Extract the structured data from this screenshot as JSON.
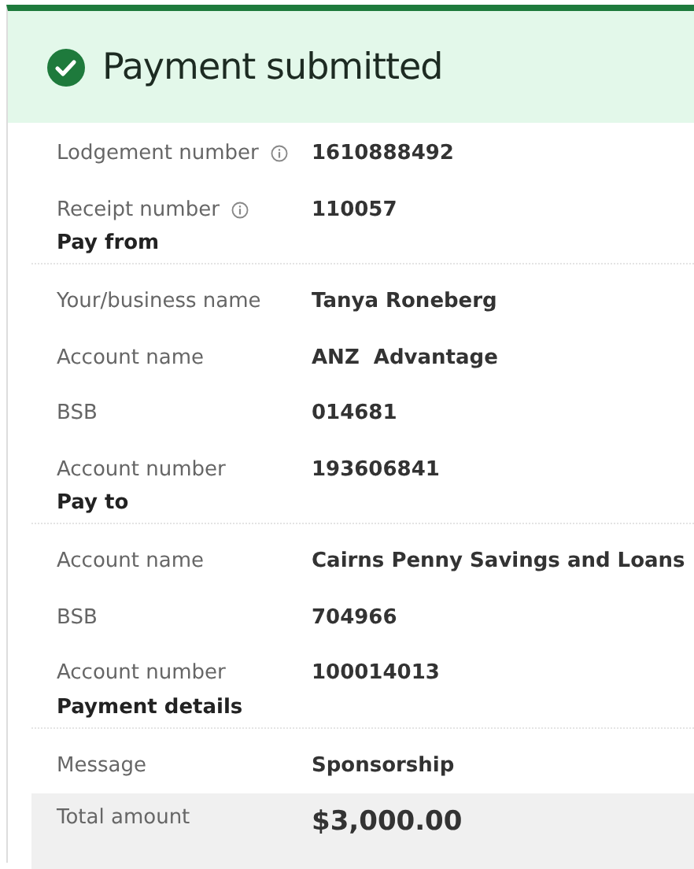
{
  "header": {
    "title": "Payment submitted"
  },
  "summary": [
    {
      "label": "Lodgement number",
      "value": "1610888492",
      "info": true
    },
    {
      "label": "Receipt number",
      "value": "110057",
      "info": true
    }
  ],
  "sections": [
    {
      "heading": "Pay from",
      "rows": [
        {
          "label": "Your/business name",
          "value": "Tanya Roneberg"
        },
        {
          "label": "Account name",
          "value": "ANZ  Advantage"
        },
        {
          "label": "BSB",
          "value": "014681"
        },
        {
          "label": "Account number",
          "value": "193606841"
        }
      ]
    },
    {
      "heading": "Pay to",
      "rows": [
        {
          "label": "Account name",
          "value": "Cairns Penny Savings and Loans"
        },
        {
          "label": "BSB",
          "value": "704966"
        },
        {
          "label": "Account number",
          "value": "100014013"
        }
      ]
    },
    {
      "heading": "Payment details",
      "rows": [
        {
          "label": "Message",
          "value": "Sponsorship"
        }
      ]
    }
  ],
  "total": {
    "label": "Total amount",
    "value": "$3,000.00"
  }
}
